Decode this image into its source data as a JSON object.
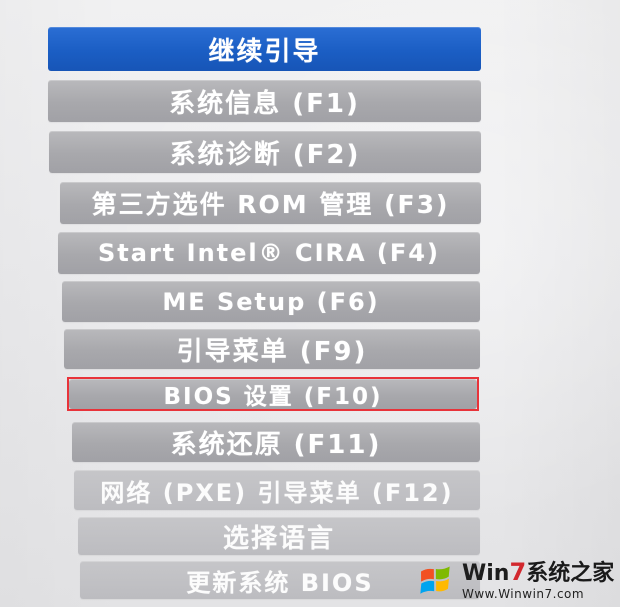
{
  "menu": {
    "items": [
      {
        "label": "继续引导",
        "selected": true
      },
      {
        "label": "系统信息 (F1)"
      },
      {
        "label": "系统诊断 (F2)"
      },
      {
        "label": "第三方选件 ROM 管理 (F3)"
      },
      {
        "label": "Start Intel® CIRA (F4)"
      },
      {
        "label": "ME Setup (F6)"
      },
      {
        "label": "引导菜单 (F9)"
      },
      {
        "label": "BIOS 设置 (F10)",
        "annotated": true
      },
      {
        "label": "系统还原 (F11)"
      },
      {
        "label": "网络 (PXE) 引导菜单 (F12)"
      },
      {
        "label": "选择语言"
      },
      {
        "label": "更新系统 BIOS"
      }
    ]
  },
  "annotation": {
    "color": "#e8333a"
  },
  "watermark": {
    "brand_prefix": "Win",
    "brand_seven": "7",
    "brand_suffix": "系统之家",
    "url": "Www.Winwin7.com"
  },
  "colors": {
    "selected": "#1b5ec4",
    "item": "#a8a8ac",
    "background": "#ececee"
  }
}
